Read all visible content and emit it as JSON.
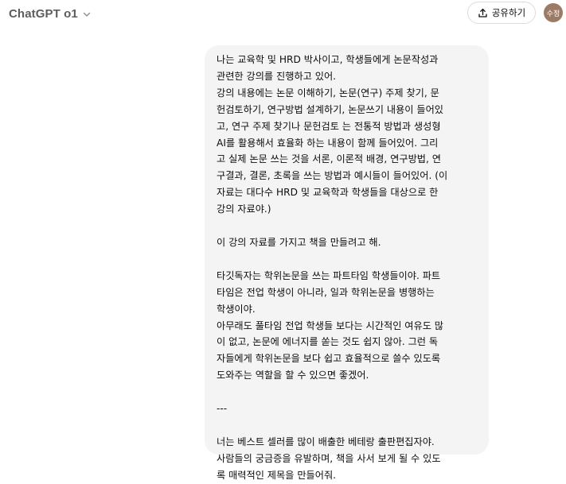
{
  "header": {
    "model_name": "ChatGPT o1",
    "model_chevron_icon": "chevron-down-icon",
    "share_label": "공유하기",
    "share_icon": "share-upload-icon",
    "avatar_text": "수정",
    "avatar_color": "#9c7b66"
  },
  "conversation": {
    "bubble_color": "#f4f4f4",
    "user_message": {
      "paragraphs": [
        "나는 교육학 및 HRD 박사이고, 학생들에게 논문작성과\n관련한 강의를 진행하고 있어.\n강의 내용에는 논문 이해하기, 논문(연구) 주제 찾기, 문\n헌검토하기, 연구방법 설계하기, 논문쓰기 내용이 들어있\n고, 연구 주제 찾기나 문헌검토 는 전통적 방법과 생성형\nAI를 활용해서 효율화 하는 내용이 함께 들어있어. 그리\n고 실제 논문 쓰는 것을 서론, 이론적 배경, 연구방법, 연\n구결과, 결론, 초록을 쓰는 방법과 예시들이 들어있어. (이\n자료는 대다수 HRD 및 교육학과 학생들을 대상으로 한\n강의 자료야.)",
        "이 강의 자료를 가지고 책을 만들려고 해.",
        "타깃독자는 학위논문을 쓰는 파트타임 학생들이야. 파트\n타임은 전업 학생이 아니라, 일과 학위논문을 병행하는\n학생이야.\n아무래도 풀타임 전업 학생들 보다는 시간적인 여유도 많\n이 없고, 논문에 에너지를 쏟는 것도 쉽지 않아. 그런 독\n자들에게 학위논문을 보다 쉽고 효율적으로 쓸수 있도록\n도와주는 역할을 할 수 있으면 좋겠어.",
        "---",
        "너는 베스트 셀러를 많이 배출한 베테랑 출판편집자야.\n사람들의 궁금증을 유발하며, 책을 사서 보게 될 수 있도\n록 매력적인 제목을 만들어줘."
      ]
    }
  }
}
